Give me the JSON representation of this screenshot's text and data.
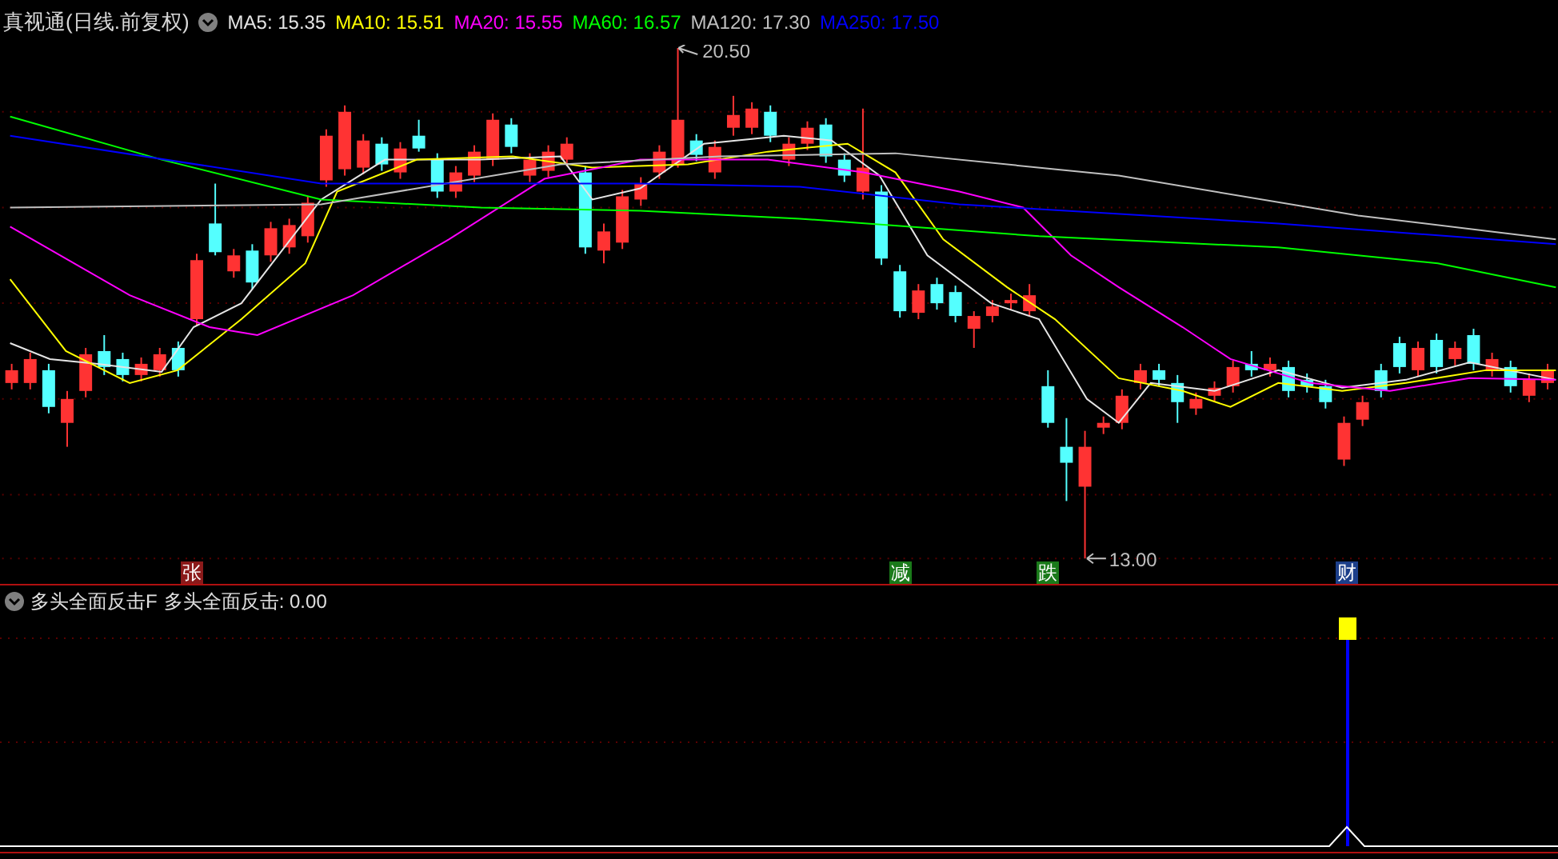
{
  "main_panel": {
    "title": "真视通(日线.前复权)",
    "moving_averages": [
      {
        "label": "MA5: 15.35",
        "color": "#e5e5e5"
      },
      {
        "label": "MA10: 15.51",
        "color": "#ffff00"
      },
      {
        "label": "MA20: 15.55",
        "color": "#ff00ff"
      },
      {
        "label": "MA60: 16.57",
        "color": "#00ff00"
      },
      {
        "label": "MA120: 17.30",
        "color": "#c0c0c0"
      },
      {
        "label": "MA250: 17.50",
        "color": "#0000ff"
      }
    ],
    "high_label": "20.50",
    "low_label": "13.00",
    "event_tags": [
      {
        "text": "张",
        "color": "#8b1a1a"
      },
      {
        "text": "减",
        "color": "#1a7a1a"
      },
      {
        "text": "跌",
        "color": "#1a7a1a"
      },
      {
        "text": "财",
        "color": "#1c3f8a"
      }
    ]
  },
  "indicator_panel": {
    "title": "多头全面反击F",
    "reading": "多头全面反击: 0.00"
  }
}
